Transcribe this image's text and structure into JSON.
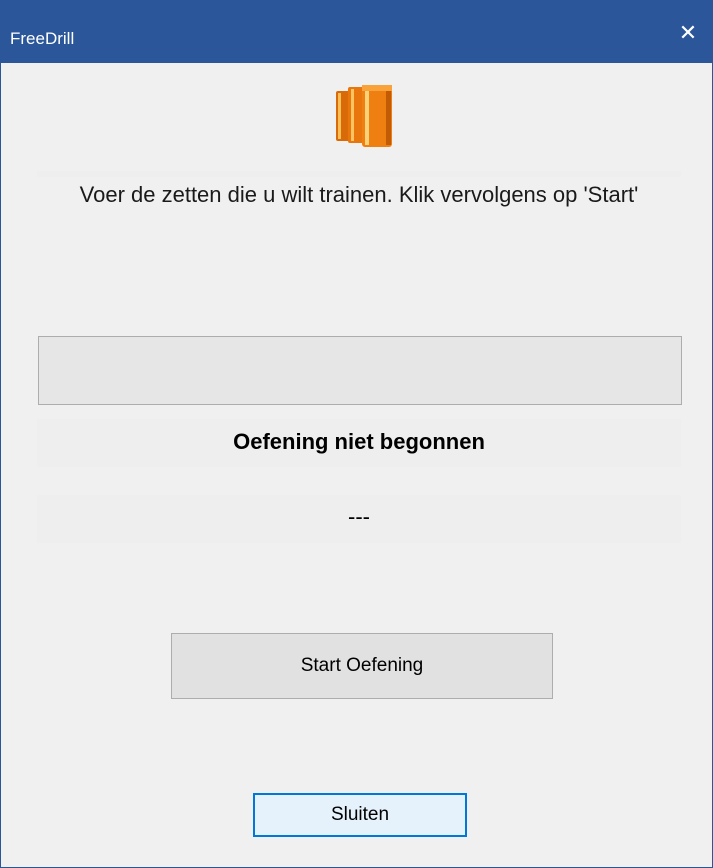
{
  "window": {
    "title": "FreeDrill",
    "close_glyph": "✕"
  },
  "icon": "books-icon",
  "instruction": "Voer de zetten die u wilt trainen. Klik vervolgens op 'Start'",
  "status": "Oefening niet begonnen",
  "result": "---",
  "buttons": {
    "start": "Start Oefening",
    "close": "Sluiten"
  },
  "colors": {
    "titlebar": "#2b579a",
    "focus_border": "#0078d7",
    "book_orange": "#f07f12"
  }
}
